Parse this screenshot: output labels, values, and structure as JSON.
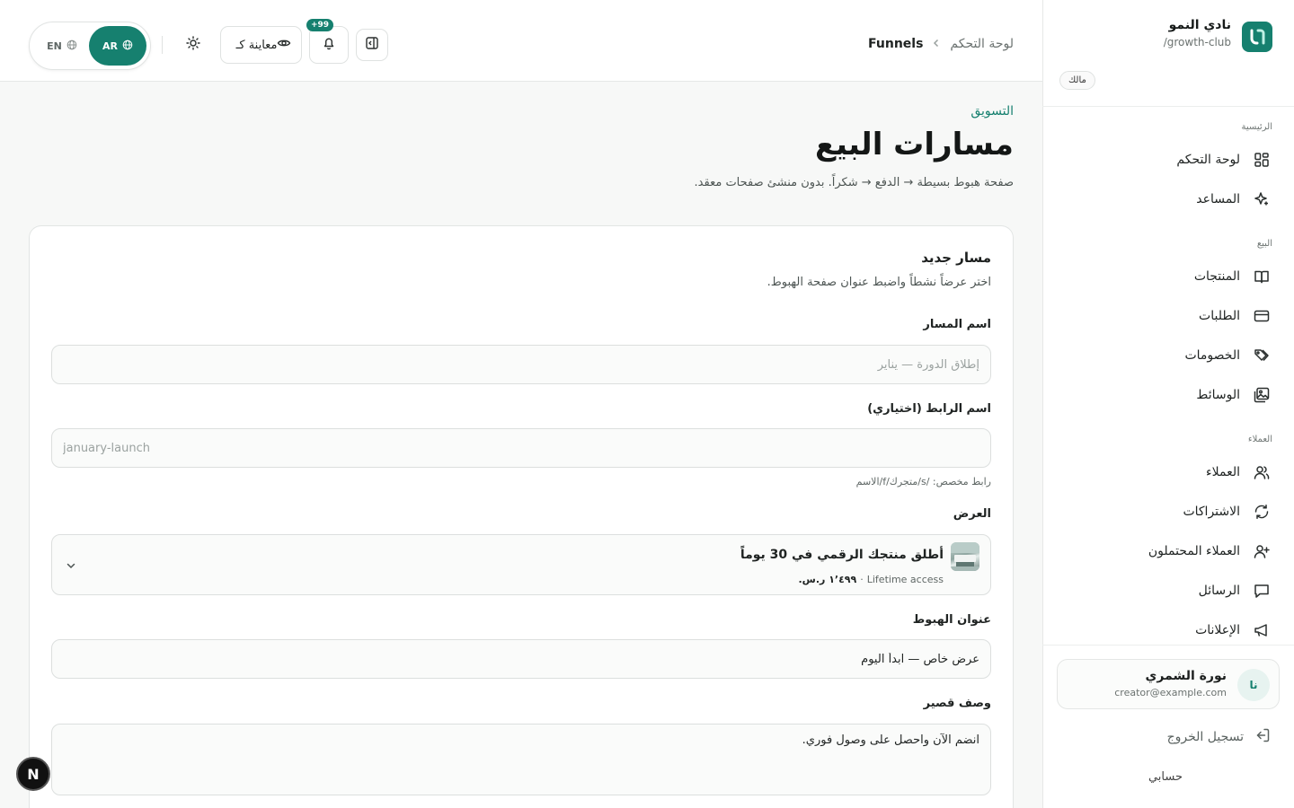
{
  "brand": {
    "name": "نادي النمو",
    "slug": "/growth-club",
    "role": "مالك"
  },
  "sidebar": {
    "sections": [
      {
        "title": "الرئيسية",
        "items": [
          {
            "label": "لوحة التحكم",
            "icon": "dashboard-icon"
          },
          {
            "label": "المساعد",
            "icon": "sparkles-icon"
          }
        ]
      },
      {
        "title": "البيع",
        "items": [
          {
            "label": "المنتجات",
            "icon": "book-icon"
          },
          {
            "label": "الطلبات",
            "icon": "credit-card-icon"
          },
          {
            "label": "الخصومات",
            "icon": "tags-icon"
          },
          {
            "label": "الوسائط",
            "icon": "images-icon"
          }
        ]
      },
      {
        "title": "العملاء",
        "items": [
          {
            "label": "العملاء",
            "icon": "users-icon"
          },
          {
            "label": "الاشتراكات",
            "icon": "refresh-icon"
          },
          {
            "label": "العملاء المحتملون",
            "icon": "user-plus-icon"
          },
          {
            "label": "الرسائل",
            "icon": "message-icon"
          },
          {
            "label": "الإعلانات",
            "icon": "megaphone-icon"
          }
        ]
      }
    ]
  },
  "user": {
    "initials": "نا",
    "name": "نورة الشمري",
    "email": "creator@example.com"
  },
  "logout_label": "تسجيل الخروج",
  "account_label": "حسابي",
  "breadcrumb": {
    "home": "لوحة التحكم",
    "current": "Funnels"
  },
  "topbar": {
    "notifications_count": "+99",
    "preview_label": "معاينة كـ",
    "lang_ar": "AR",
    "lang_en": "EN"
  },
  "page": {
    "eyebrow": "التسويق",
    "title": "مسارات البيع",
    "subtitle": "صفحة هبوط بسيطة → الدفع → شكراً. بدون منشئ صفحات معقد."
  },
  "form": {
    "title": "مسار جديد",
    "description": "اختر عرضاً نشطاً واضبط عنوان صفحة الهبوط.",
    "name_label": "اسم المسار",
    "name_placeholder": "إطلاق الدورة — يناير",
    "slug_label": "اسم الرابط (اختياري)",
    "slug_placeholder": "january-launch",
    "slug_hint": "رابط مخصص: /s/متجرك/f/الاسم",
    "offer_label": "العرض",
    "offer": {
      "title": "أطلق منتجك الرقمي في 30 يوماً",
      "access": "Lifetime access",
      "separator": "·",
      "price": "١٬٤٩٩ ر.س."
    },
    "headline_label": "عنوان الهبوط",
    "headline_value": "عرض خاص — ابدأ اليوم",
    "short_desc_label": "وصف قصير",
    "short_desc_value": "انضم الآن واحصل على وصول فوري."
  },
  "dev_badge": "N",
  "colors": {
    "accent": "#16806f",
    "text": "#1f2322",
    "muted": "#6b7270",
    "border": "#dfe2e1"
  }
}
